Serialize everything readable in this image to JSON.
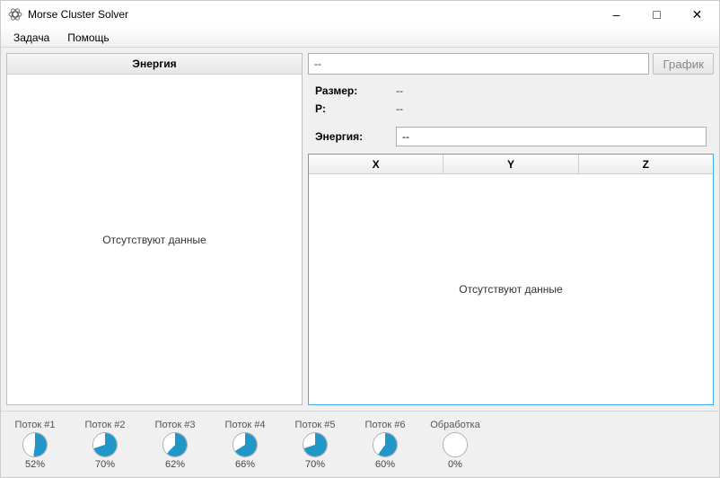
{
  "window": {
    "title": "Morse Cluster Solver"
  },
  "menu": {
    "task": "Задача",
    "help": "Помощь"
  },
  "left": {
    "header": "Энергия",
    "empty": "Отсутствуют данные"
  },
  "right": {
    "input_value": "--",
    "graph_button": "График",
    "info": {
      "size_label": "Размер:",
      "size_value": "--",
      "p_label": "P:",
      "p_value": "--",
      "energy_label": "Энергия:",
      "energy_value": "--"
    },
    "table": {
      "x": "X",
      "y": "Y",
      "z": "Z",
      "empty": "Отсутствуют данные"
    }
  },
  "threads": [
    {
      "label": "Поток #1",
      "percent": "52%",
      "pct": 52
    },
    {
      "label": "Поток #2",
      "percent": "70%",
      "pct": 70
    },
    {
      "label": "Поток #3",
      "percent": "62%",
      "pct": 62
    },
    {
      "label": "Поток #4",
      "percent": "66%",
      "pct": 66
    },
    {
      "label": "Поток #5",
      "percent": "70%",
      "pct": 70
    },
    {
      "label": "Поток #6",
      "percent": "60%",
      "pct": 60
    },
    {
      "label": "Обработка",
      "percent": "0%",
      "pct": 0
    }
  ]
}
